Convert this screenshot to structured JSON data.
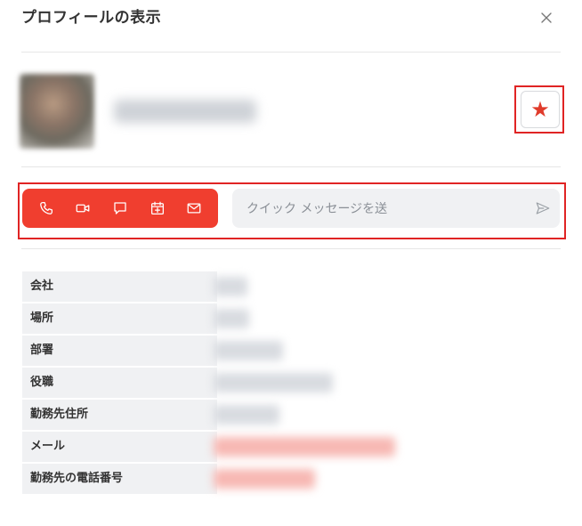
{
  "dialog": {
    "title": "プロフィールの表示",
    "close_icon": "close-icon"
  },
  "profile": {
    "avatar_icon": "avatar",
    "favorite_icon": "star-icon",
    "favorite_color": "#e03b2b"
  },
  "actions": {
    "accent_color": "#f03e2f",
    "items": [
      "phone-icon",
      "video-icon",
      "chat-icon",
      "calendar-add-icon",
      "mail-icon"
    ]
  },
  "quick_message": {
    "placeholder": "クイック メッセージを送",
    "send_icon": "send-icon"
  },
  "info": {
    "rows": [
      {
        "label": "会社"
      },
      {
        "label": "場所"
      },
      {
        "label": "部署"
      },
      {
        "label": "役職"
      },
      {
        "label": "勤務先住所"
      },
      {
        "label": "メール"
      },
      {
        "label": "勤務先の電話番号"
      }
    ]
  },
  "highlight_color": "#e02424"
}
